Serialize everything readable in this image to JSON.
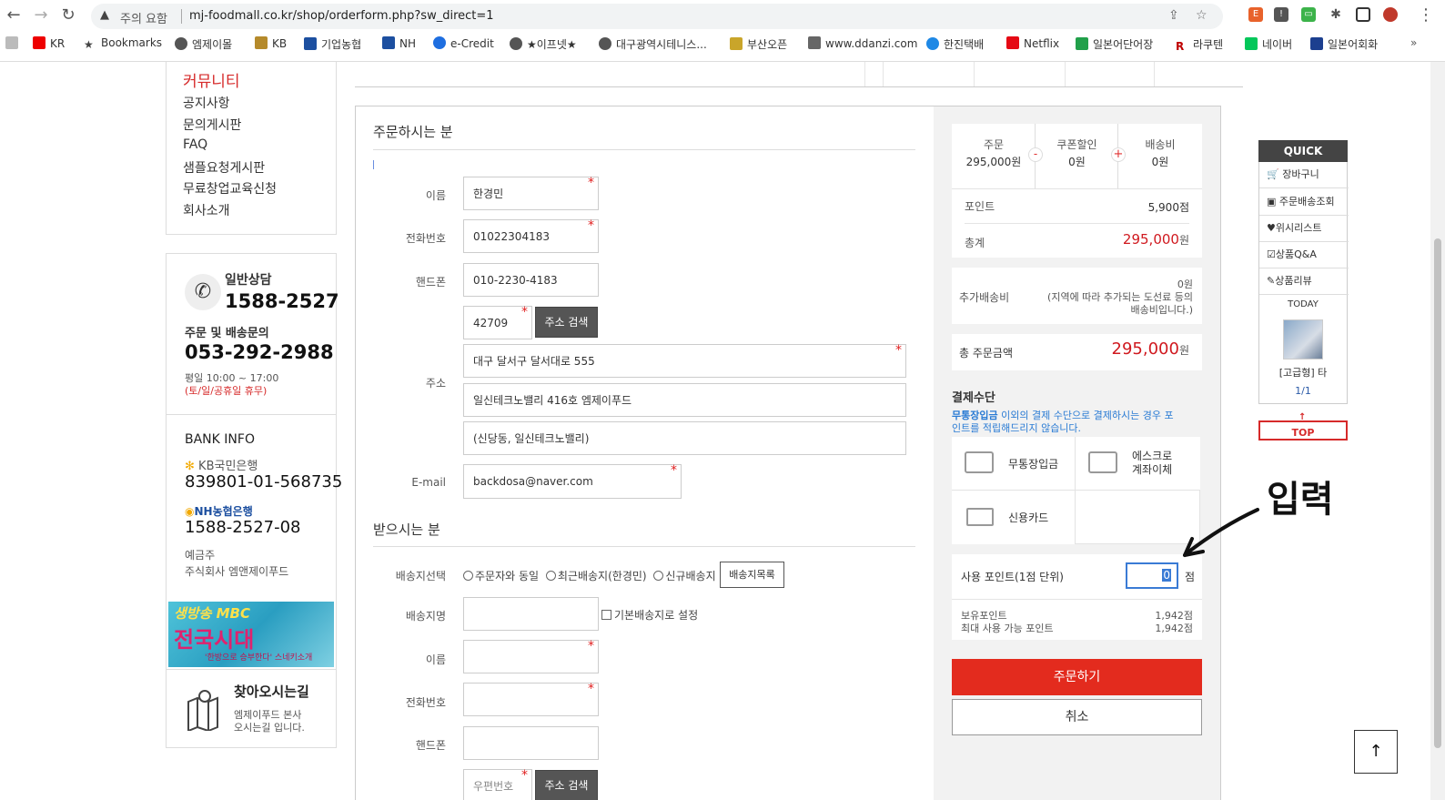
{
  "browser": {
    "warning": "주의 요함",
    "url": "mj-foodmall.co.kr/shop/orderform.php?sw_direct=1",
    "bookmarks": [
      "KR",
      "Bookmarks",
      "엠제이몰",
      "KB",
      "기업농협",
      "NH",
      "e-Credit",
      "★이프넷★",
      "대구광역시테니스...",
      "부산오픈",
      "www.ddanzi.com",
      "한진택배",
      "Netflix",
      "일본어단어장",
      "라쿠텐",
      "네이버",
      "일본어회화"
    ]
  },
  "sidebar": {
    "community_title": "커뮤니티",
    "community_items": [
      "공지사항",
      "문의게시판",
      "FAQ",
      "샘플요청게시판",
      "무료창업교육신청",
      "회사소개"
    ],
    "consult_label": "일반상담",
    "consult_phone": "1588-2527",
    "delivery_label": "주문 및 배송문의",
    "delivery_phone": "053-292-2988",
    "hours": "평일 10:00 ~ 17:00",
    "holiday": "(토/일/공휴일 휴무)",
    "bank_title": "BANK INFO",
    "kb_name": "KB국민은행",
    "kb_account": "839801-01-568735",
    "nh_name": "NH농협은행",
    "nh_account": "1588-2527-08",
    "holder_label": "예금주",
    "holder_name": "주식회사 엠앤제이푸드",
    "banner_top": "생방송 MBC",
    "banner_main": "전국시대",
    "banner_sub": "'한방으로 승부한다' 스네키소개",
    "directions_title": "찾아오시는길",
    "directions_line1": "엠제이푸드 본사",
    "directions_line2": "오시는길 입니다."
  },
  "orderer": {
    "title": "주문하시는 분",
    "name_label": "이름",
    "name_value": "한경민",
    "phone_label": "전화번호",
    "phone_value": "01022304183",
    "mobile_label": "핸드폰",
    "mobile_value": "010-2230-4183",
    "zip_value": "42709",
    "zip_button": "주소 검색",
    "address_label": "주소",
    "address1": "대구 달서구 달서대로 555",
    "address2": "일신테크노밸리 416호 엠제이푸드",
    "address3": "(신당동, 일신테크노밸리)",
    "email_label": "E-mail",
    "email_value": "backdosa@naver.com"
  },
  "receiver": {
    "title": "받으시는 분",
    "select_label": "배송지선택",
    "option_same": "주문자와 동일",
    "option_recent": "최근배송지(한경민)",
    "option_new": "신규배송지",
    "list_button": "배송지목록",
    "place_label": "배송지명",
    "default_label": "기본배송지로 설정",
    "name_label": "이름",
    "phone_label": "전화번호",
    "mobile_label": "핸드폰",
    "zip_placeholder": "우편번호",
    "zip_button": "주소 검색"
  },
  "summary": {
    "order_label": "주문",
    "order_value": "295,000원",
    "minus": "-",
    "coupon_label": "쿠폰할인",
    "coupon_value": "0원",
    "plus": "+",
    "shipping_label": "배송비",
    "shipping_value": "0원",
    "point_label": "포인트",
    "point_value": "5,900점",
    "total_label": "총계",
    "total_value": "295,000",
    "total_unit": "원",
    "extra_label": "추가배송비",
    "extra_value": "0원",
    "extra_note1": "(지역에 따라 추가되는 도선료 등의",
    "extra_note2": "배송비입니다.)",
    "grand_label": "총 주문금액",
    "grand_value": "295,000",
    "grand_unit": "원"
  },
  "payment": {
    "title": "결제수단",
    "note_highlight": "무통장입금",
    "note_rest": " 이외의 결제 수단으로 결제하시는 경우 포",
    "note_line2": "인트를 적립해드리지 않습니다.",
    "method_bank": "무통장입금",
    "method_escrow1": "에스크로",
    "method_escrow2": "계좌이체",
    "method_card": "신용카드",
    "use_point_label": "사용 포인트(1점 단위)",
    "use_point_value": "0",
    "use_point_unit": "점",
    "own_point_label": "보유포인트",
    "own_point_value": "1,942점",
    "max_point_label": "최대 사용 가능 포인트",
    "max_point_value": "1,942점",
    "order_button": "주문하기",
    "cancel_button": "취소"
  },
  "annotation": {
    "text": "입력"
  },
  "quick": {
    "title": "QUICK",
    "items": [
      "장바구니",
      "주문배송조회",
      "위시리스트",
      "상품Q&A",
      "상품리뷰"
    ],
    "today": "TODAY",
    "product": "[고급형] 타",
    "page": "1/1",
    "top": "TOP"
  },
  "colors": {
    "accent_red": "#e32b1e",
    "price_red": "#d0191f",
    "link_blue": "#2a7bd4"
  }
}
